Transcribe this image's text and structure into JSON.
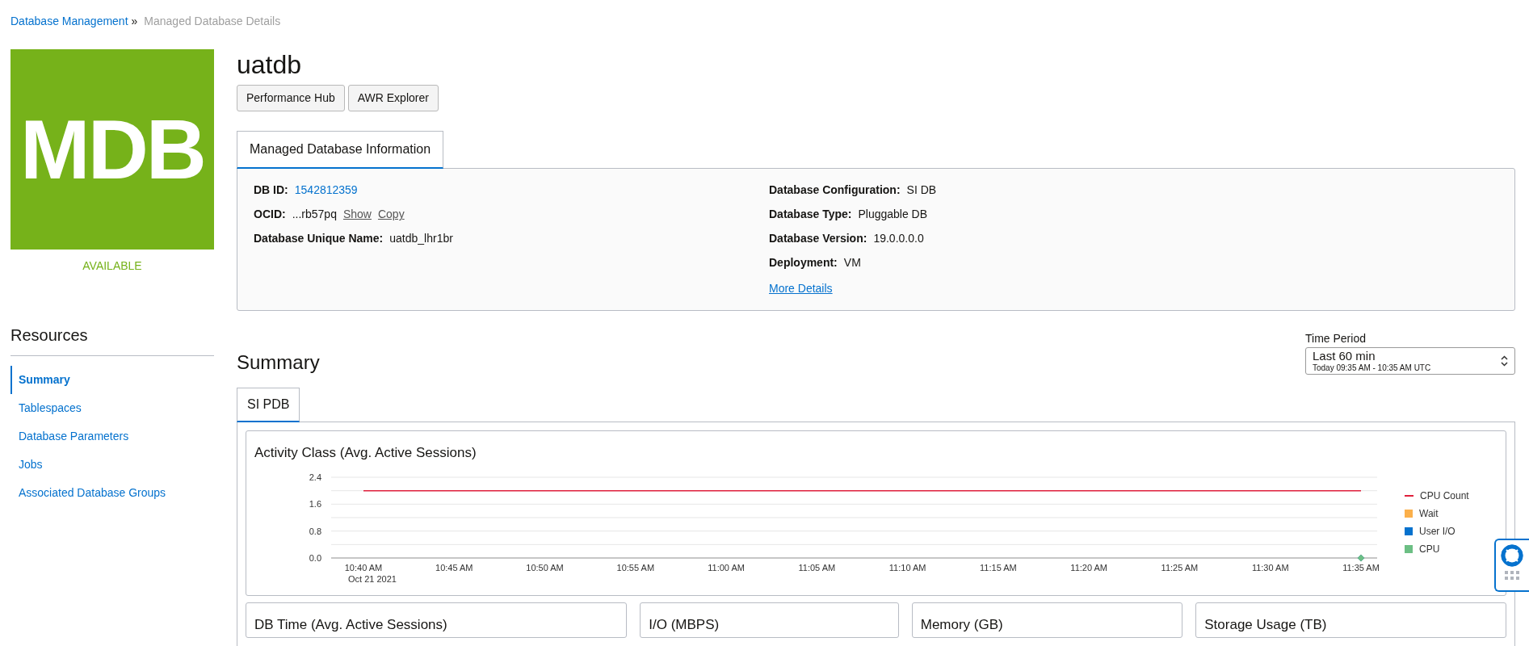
{
  "breadcrumb": [
    {
      "label": "Database Management",
      "link": true
    },
    {
      "label": "Managed Database Details",
      "link": false
    }
  ],
  "breadcrumb_separator": "»",
  "logo": {
    "text": "MDB",
    "status": "AVAILABLE"
  },
  "title": "uatdb",
  "actions": [
    "Performance Hub",
    "AWR Explorer"
  ],
  "info_tabs": [
    {
      "label": "Managed Database Information",
      "selected": true
    }
  ],
  "info": {
    "left": [
      {
        "label": "DB ID:",
        "value": "1542812359",
        "kind": "link"
      },
      {
        "label": "OCID:",
        "value": "...rb57pq",
        "kind": "ocid",
        "links": [
          "Show",
          "Copy"
        ]
      },
      {
        "label": "Database Unique Name:",
        "value": "uatdb_lhr1br",
        "kind": "text"
      }
    ],
    "right": [
      {
        "label": "Database Configuration:",
        "value": "SI DB",
        "kind": "text"
      },
      {
        "label": "Database Type:",
        "value": "Pluggable DB",
        "kind": "text"
      },
      {
        "label": "Database Version:",
        "value": "19.0.0.0.0",
        "kind": "text"
      },
      {
        "label": "Deployment:",
        "value": "VM",
        "kind": "text"
      }
    ],
    "more_details": "More Details"
  },
  "resources": {
    "title": "Resources",
    "items": [
      {
        "label": "Summary",
        "selected": true
      },
      {
        "label": "Tablespaces",
        "selected": false
      },
      {
        "label": "Database Parameters",
        "selected": false
      },
      {
        "label": "Jobs",
        "selected": false
      },
      {
        "label": "Associated Database Groups",
        "selected": false
      }
    ]
  },
  "summary": {
    "title": "Summary",
    "time_period": {
      "label": "Time Period",
      "value": "Last 60 min",
      "detail": "Today 09:35 AM - 10:35 AM UTC"
    },
    "tabs": [
      {
        "label": "SI PDB",
        "selected": true
      }
    ],
    "activity": {
      "title": "Activity Class (Avg. Active Sessions)",
      "chart_data": {
        "type": "line",
        "categories": [
          "10:40 AM",
          "10:45 AM",
          "10:50 AM",
          "10:55 AM",
          "11:00 AM",
          "11:05 AM",
          "11:10 AM",
          "11:15 AM",
          "11:20 AM",
          "11:25 AM",
          "11:30 AM",
          "11:35 AM"
        ],
        "ylim": [
          0,
          2.4
        ],
        "yticks": [
          {
            "value": 0,
            "label": "0.0"
          },
          {
            "value": 0.8,
            "label": "0.8"
          },
          {
            "value": 1.6,
            "label": "1.6"
          },
          {
            "value": 2.4,
            "label": "2.4"
          }
        ],
        "series": [
          {
            "name": "CPU Count",
            "color": "#e0203c",
            "values": [
              2,
              2,
              2,
              2,
              2,
              2,
              2,
              2,
              2,
              2,
              2,
              2
            ]
          },
          {
            "name": "Wait",
            "color": "#fbb04b",
            "marker": "diamond",
            "values": [
              null,
              null,
              null,
              null,
              null,
              null,
              null,
              null,
              null,
              null,
              null,
              0
            ]
          },
          {
            "name": "User I/O",
            "color": "#0572ce",
            "marker": "diamond",
            "values": [
              null,
              null,
              null,
              null,
              null,
              null,
              null,
              null,
              null,
              null,
              null,
              0
            ]
          },
          {
            "name": "CPU",
            "color": "#6cbf84",
            "marker": "diamond",
            "values": [
              null,
              null,
              null,
              null,
              null,
              null,
              null,
              null,
              null,
              null,
              null,
              0
            ]
          }
        ],
        "annotations": [
          "Oct 21 2021"
        ]
      }
    },
    "cards": [
      "DB Time (Avg. Active Sessions)",
      "I/O (MBPS)",
      "Memory (GB)",
      "Storage Usage (TB)"
    ]
  }
}
